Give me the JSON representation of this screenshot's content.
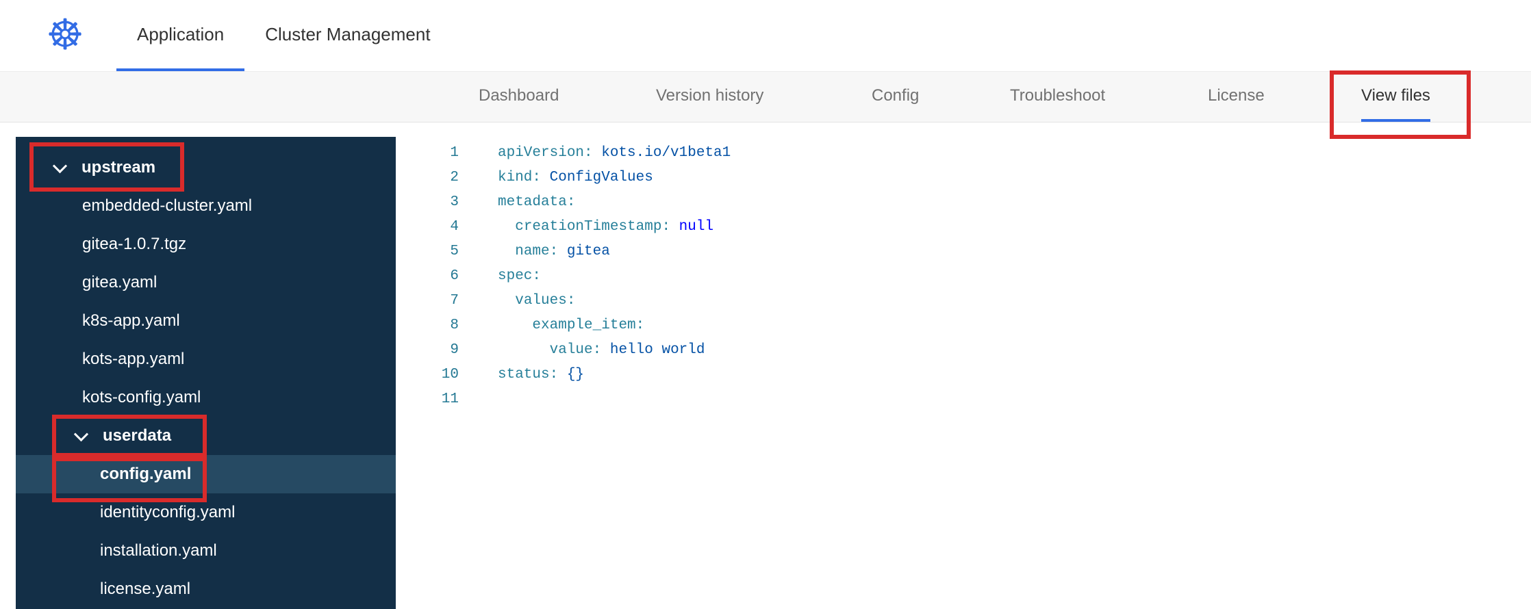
{
  "colors": {
    "accent-blue": "#326de6",
    "logo-blue": "#326ce5",
    "annotation-red": "#d92b2b",
    "sidebar-bg": "#132f47",
    "sidebar-selected": "#264a63",
    "subnav-bg": "#f7f7f7",
    "text-dark": "#323232",
    "text-muted": "#717171",
    "code-key": "#267f99",
    "code-value": "#0451a5",
    "code-keyword": "#0000ff",
    "code-punct": "#0451a5",
    "line-number": "#237893"
  },
  "header": {
    "logo": {
      "name": "kubernetes-logo",
      "glyph": "☸"
    },
    "tabs": [
      {
        "label": "Application",
        "active": true
      },
      {
        "label": "Cluster Management",
        "active": false
      }
    ]
  },
  "subnav": {
    "tabs": [
      {
        "label": "Dashboard",
        "active": false
      },
      {
        "label": "Version history",
        "active": false
      },
      {
        "label": "Config",
        "active": false
      },
      {
        "label": "Troubleshoot",
        "active": false
      },
      {
        "label": "License",
        "active": false
      },
      {
        "label": "View files",
        "active": true
      }
    ]
  },
  "file_tree": {
    "items": [
      {
        "type": "folder",
        "label": "upstream",
        "level": 0,
        "expanded": true
      },
      {
        "type": "file",
        "label": "embedded-cluster.yaml",
        "level": 0
      },
      {
        "type": "file",
        "label": "gitea-1.0.7.tgz",
        "level": 0
      },
      {
        "type": "file",
        "label": "gitea.yaml",
        "level": 0
      },
      {
        "type": "file",
        "label": "k8s-app.yaml",
        "level": 0
      },
      {
        "type": "file",
        "label": "kots-app.yaml",
        "level": 0
      },
      {
        "type": "file",
        "label": "kots-config.yaml",
        "level": 0
      },
      {
        "type": "folder",
        "label": "userdata",
        "level": 1,
        "expanded": true
      },
      {
        "type": "file",
        "label": "config.yaml",
        "level": 1,
        "selected": true
      },
      {
        "type": "file",
        "label": "identityconfig.yaml",
        "level": 1
      },
      {
        "type": "file",
        "label": "installation.yaml",
        "level": 1
      },
      {
        "type": "file",
        "label": "license.yaml",
        "level": 1
      }
    ]
  },
  "editor": {
    "language": "yaml",
    "lines": [
      {
        "n": "1",
        "tokens": [
          [
            "key",
            "apiVersion:"
          ],
          [
            "val",
            " kots.io/v1beta1"
          ]
        ]
      },
      {
        "n": "2",
        "tokens": [
          [
            "key",
            "kind:"
          ],
          [
            "val",
            " ConfigValues"
          ]
        ]
      },
      {
        "n": "3",
        "tokens": [
          [
            "key",
            "metadata:"
          ]
        ]
      },
      {
        "n": "4",
        "tokens": [
          [
            "plain",
            "  "
          ],
          [
            "key",
            "creationTimestamp:"
          ],
          [
            "kw",
            " null"
          ]
        ]
      },
      {
        "n": "5",
        "tokens": [
          [
            "plain",
            "  "
          ],
          [
            "key",
            "name:"
          ],
          [
            "val",
            " gitea"
          ]
        ]
      },
      {
        "n": "6",
        "tokens": [
          [
            "key",
            "spec:"
          ]
        ]
      },
      {
        "n": "7",
        "tokens": [
          [
            "plain",
            "  "
          ],
          [
            "key",
            "values:"
          ]
        ]
      },
      {
        "n": "8",
        "tokens": [
          [
            "plain",
            "    "
          ],
          [
            "key",
            "example_item:"
          ]
        ]
      },
      {
        "n": "9",
        "tokens": [
          [
            "plain",
            "      "
          ],
          [
            "key",
            "value:"
          ],
          [
            "val",
            " hello world"
          ]
        ]
      },
      {
        "n": "10",
        "tokens": [
          [
            "key",
            "status:"
          ],
          [
            "pn",
            " {}"
          ]
        ]
      },
      {
        "n": "11",
        "tokens": []
      }
    ]
  },
  "annotations": {
    "highlighted_items": [
      "View files",
      "upstream",
      "userdata",
      "config.yaml"
    ]
  }
}
